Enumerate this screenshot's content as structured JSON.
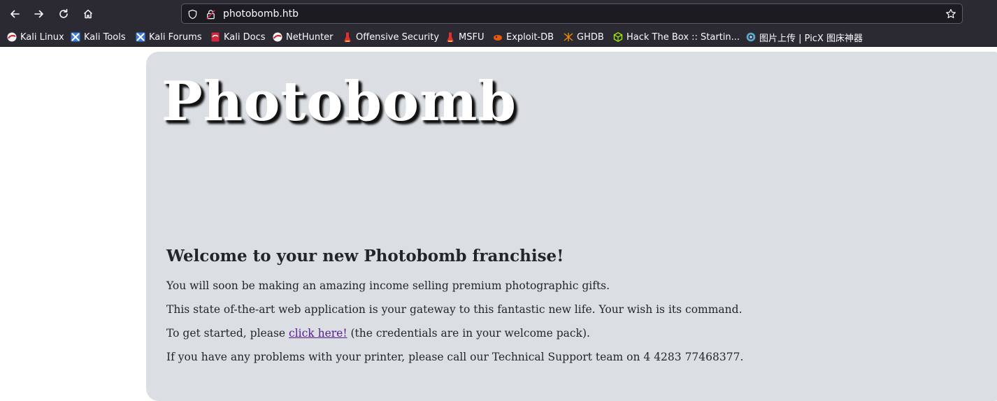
{
  "browser": {
    "url": "photobomb.htb",
    "nav_icons": [
      "back-arrow-icon",
      "forward-arrow-icon",
      "reload-icon",
      "home-icon"
    ],
    "bookmarks": [
      {
        "label": "Kali Linux",
        "icon": "kali-icon"
      },
      {
        "label": "Kali Tools",
        "icon": "kali-tools-icon"
      },
      {
        "label": "Kali Forums",
        "icon": "kali-forums-icon"
      },
      {
        "label": "Kali Docs",
        "icon": "kali-docs-icon"
      },
      {
        "label": "NetHunter",
        "icon": "kali-icon"
      },
      {
        "label": "Offensive Security",
        "icon": "offsec-icon"
      },
      {
        "label": "MSFU",
        "icon": "offsec-icon"
      },
      {
        "label": "Exploit-DB",
        "icon": "exploit-db-icon"
      },
      {
        "label": "GHDB",
        "icon": "ghdb-icon"
      },
      {
        "label": "Hack The Box :: Startin...",
        "icon": "htb-icon"
      },
      {
        "label": "图片上传 | PicX 图床神器",
        "icon": "picx-icon"
      }
    ]
  },
  "page": {
    "logo": "Photobomb",
    "heading": "Welcome to your new Photobomb franchise!",
    "p1": "You will soon be making an amazing income selling premium photographic gifts.",
    "p2": "This state of-the-art web application is your gateway to this fantastic new life. Your wish is its command.",
    "p3_before": "To get started, please ",
    "p3_link": "click here!",
    "p3_after": " (the credentials are in your welcome pack).",
    "p4": "If you have any problems with your printer, please call our Technical Support team on 4 4283 77468377."
  },
  "colors": {
    "chrome": "#2b2a33",
    "panel": "#dbdfe3",
    "link_visited": "#551a8b"
  }
}
